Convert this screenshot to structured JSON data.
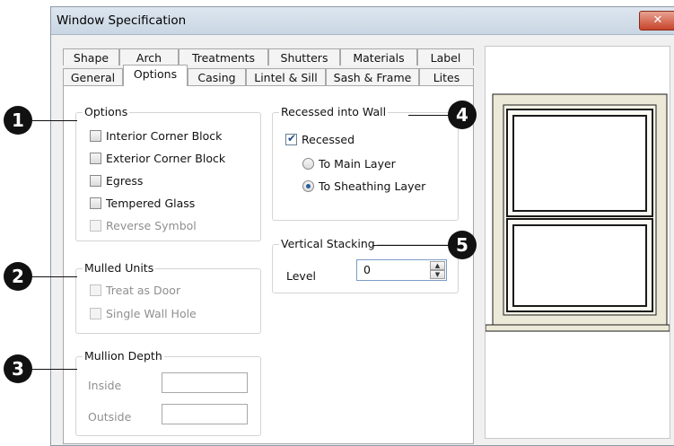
{
  "window": {
    "title": "Window Specification",
    "close_glyph": "✕"
  },
  "tabs": {
    "row1": [
      "Shape",
      "Arch",
      "Treatments",
      "Shutters",
      "Materials",
      "Label"
    ],
    "row2": [
      "General",
      "Options",
      "Casing",
      "Lintel & Sill",
      "Sash & Frame",
      "Lites"
    ],
    "active": "Options"
  },
  "options_group": {
    "label": "Options",
    "items": [
      {
        "label": "Interior Corner Block",
        "checked": false,
        "disabled": false
      },
      {
        "label": "Exterior Corner Block",
        "checked": false,
        "disabled": false
      },
      {
        "label": "Egress",
        "checked": false,
        "disabled": false
      },
      {
        "label": "Tempered Glass",
        "checked": false,
        "disabled": false
      },
      {
        "label": "Reverse Symbol",
        "checked": false,
        "disabled": true
      }
    ]
  },
  "mulled_group": {
    "label": "Mulled Units",
    "items": [
      {
        "label": "Treat as Door",
        "checked": false,
        "disabled": true
      },
      {
        "label": "Single Wall Hole",
        "checked": false,
        "disabled": true
      }
    ]
  },
  "mullion_group": {
    "label": "Mullion Depth",
    "inside_label": "Inside",
    "inside_value": "",
    "outside_label": "Outside",
    "outside_value": ""
  },
  "recessed_group": {
    "label": "Recessed into Wall",
    "recessed_label": "Recessed",
    "recessed_checked": true,
    "radio_main": "To Main Layer",
    "radio_sheathing": "To Sheathing Layer",
    "selected": "To Sheathing Layer"
  },
  "stacking_group": {
    "label": "Vertical Stacking",
    "level_label": "Level",
    "level_value": "0"
  },
  "callouts": [
    "1",
    "2",
    "3",
    "4",
    "5"
  ],
  "colors": {
    "frame_stroke": "#1a1a1a",
    "frame_fill": "#ece9d8",
    "callout": "#111111"
  }
}
